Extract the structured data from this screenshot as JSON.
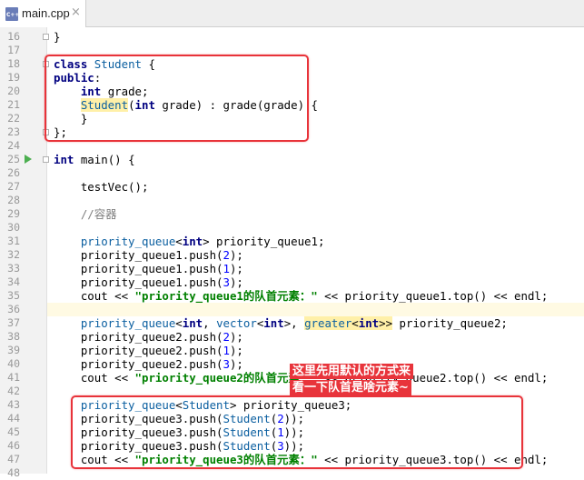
{
  "tab": {
    "icon_text": "C++",
    "filename": "main.cpp",
    "close": "×"
  },
  "lines": [
    {
      "n": "16",
      "t": "}"
    },
    {
      "n": "17",
      "t": ""
    },
    {
      "n": "18",
      "t": "class Student {"
    },
    {
      "n": "19",
      "t": "public:"
    },
    {
      "n": "20",
      "t": "    int grade;"
    },
    {
      "n": "21",
      "t": "    Student(int grade) : grade(grade) {"
    },
    {
      "n": "22",
      "t": "    }"
    },
    {
      "n": "23",
      "t": "};"
    },
    {
      "n": "24",
      "t": ""
    },
    {
      "n": "25",
      "t": "int main() {"
    },
    {
      "n": "26",
      "t": ""
    },
    {
      "n": "27",
      "t": "    testVec();"
    },
    {
      "n": "28",
      "t": ""
    },
    {
      "n": "29",
      "t": "    //容器"
    },
    {
      "n": "30",
      "t": ""
    },
    {
      "n": "31",
      "t": "    priority_queue<int> priority_queue1;"
    },
    {
      "n": "32",
      "t": "    priority_queue1.push(2);"
    },
    {
      "n": "33",
      "t": "    priority_queue1.push(1);"
    },
    {
      "n": "34",
      "t": "    priority_queue1.push(3);"
    },
    {
      "n": "35",
      "t": "    cout << \"priority_queue1的队首元素：\" << priority_queue1.top() << endl;"
    },
    {
      "n": "36",
      "t": ""
    },
    {
      "n": "37",
      "t": "    priority_queue<int, vector<int>, greater<int>> priority_queue2;"
    },
    {
      "n": "38",
      "t": "    priority_queue2.push(2);"
    },
    {
      "n": "39",
      "t": "    priority_queue2.push(1);"
    },
    {
      "n": "40",
      "t": "    priority_queue2.push(3);"
    },
    {
      "n": "41",
      "t": "    cout << \"priority_queue2的队首元素：\" << priority_queue2.top() << endl;"
    },
    {
      "n": "42",
      "t": ""
    },
    {
      "n": "43",
      "t": "    priority_queue<Student> priority_queue3;"
    },
    {
      "n": "44",
      "t": "    priority_queue3.push(Student(2));"
    },
    {
      "n": "45",
      "t": "    priority_queue3.push(Student(1));"
    },
    {
      "n": "46",
      "t": "    priority_queue3.push(Student(3));"
    },
    {
      "n": "47",
      "t": "    cout << \"priority_queue3的队首元素：\" << priority_queue3.top() << endl;"
    },
    {
      "n": "48",
      "t": ""
    }
  ],
  "annotation": {
    "line1": "这里先用默认的方式来",
    "line2": "看一下队首是啥元素~"
  },
  "colors": {
    "highlight": "#e8333a",
    "keyword": "#000080",
    "string": "#008000",
    "number": "#0000ff",
    "comment": "#808080",
    "run": "#4caf50"
  }
}
